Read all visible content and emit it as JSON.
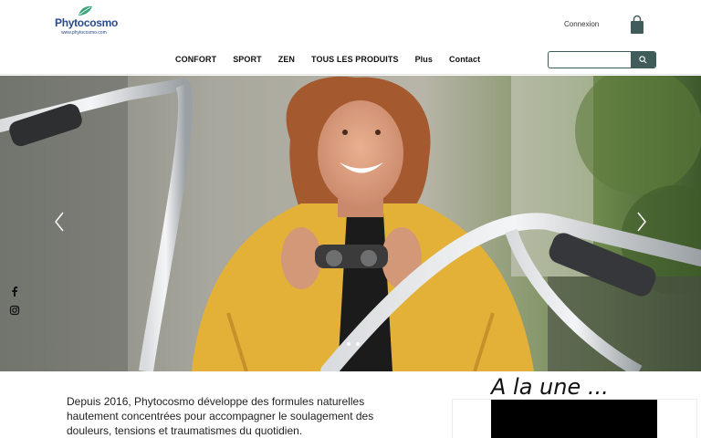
{
  "brand": {
    "name": "Phytocosmo",
    "url": "www.phytocosmo.com"
  },
  "header": {
    "login_label": "Connexion",
    "cart_icon": "shopping-bag-icon"
  },
  "nav": {
    "items": [
      {
        "label": "CONFORT"
      },
      {
        "label": "SPORT"
      },
      {
        "label": "ZEN"
      },
      {
        "label": "TOUS LES PRODUITS"
      },
      {
        "label": "Plus"
      },
      {
        "label": "Contact"
      }
    ]
  },
  "search": {
    "value": "",
    "placeholder": "",
    "icon": "search-icon"
  },
  "hero": {
    "slide_count": 2,
    "active_slide": 1
  },
  "social": [
    {
      "name": "facebook-icon"
    },
    {
      "name": "instagram-icon"
    }
  ],
  "intro": {
    "text": "Depuis 2016, Phytocosmo développe des formules naturelles hautement concentrées pour accompagner le soulagement des douleurs, tensions et traumatismes du quotidien."
  },
  "featured": {
    "heading": "A la une ..."
  },
  "colors": {
    "accent": "#3f5c5a",
    "brand": "#2a4a8a",
    "leaf": "#3aa57a",
    "jacket": "#e6b23a"
  }
}
